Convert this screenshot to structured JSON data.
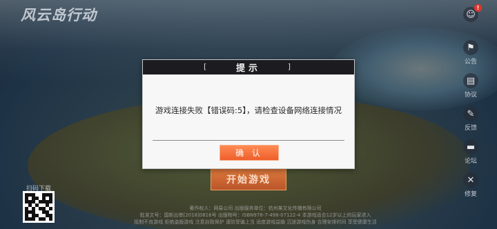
{
  "app": {
    "logo_text": "风云岛行动"
  },
  "side_menu": [
    {
      "label": "",
      "icon": "friends-icon",
      "badge": "!"
    },
    {
      "label": "公告",
      "icon": "flag-icon",
      "badge": ""
    },
    {
      "label": "协议",
      "icon": "document-icon",
      "badge": ""
    },
    {
      "label": "反馈",
      "icon": "feedback-icon",
      "badge": ""
    },
    {
      "label": "论坛",
      "icon": "forum-icon",
      "badge": ""
    },
    {
      "label": "修复",
      "icon": "wrench-icon",
      "badge": ""
    }
  ],
  "start_button": {
    "label": "开始游戏"
  },
  "qr": {
    "label": "扫码下载"
  },
  "footer": {
    "line1": "著作权人：网易公司    出版服务单位：杭州某文化传播有限公司",
    "line2": "批准文号：国新出审[2018]0816号    出版物号：ISBN978-7-498-07122-4    本游戏适合12岁以上的玩家进入",
    "line3": "抵制不良游戏 拒绝盗版游戏 注意自我保护 谨防受骗上当 适度游戏益脑 沉迷游戏伤身 合理安排时间 享受健康生活"
  },
  "dialog": {
    "title": "提示",
    "bracket_left": "[",
    "bracket_right": "]",
    "message": "游戏连接失败【错误码:5】，请检查设备网络连接情况",
    "confirm_label": "确 认"
  }
}
